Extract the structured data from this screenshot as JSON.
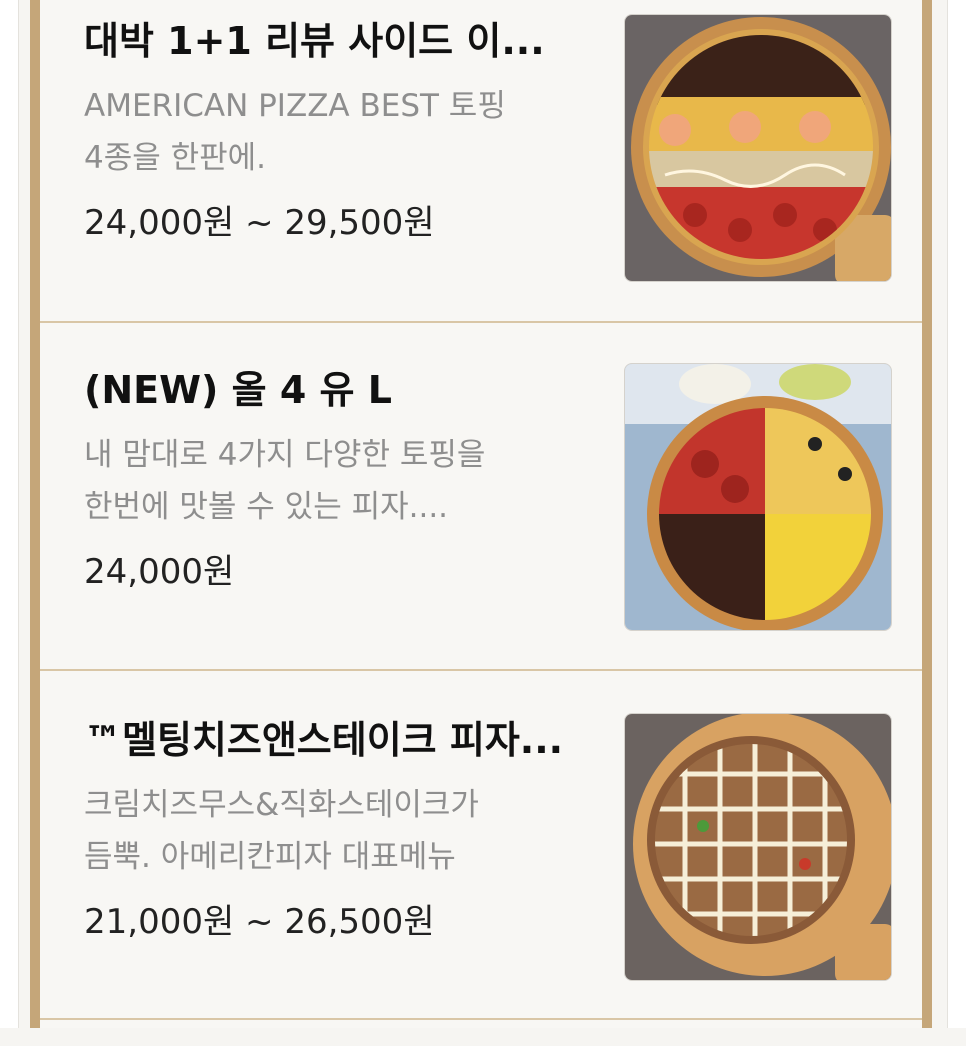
{
  "menu": {
    "items": [
      {
        "name": "대박 1+1 리뷰 사이드 이...",
        "description_line1": "AMERICAN PIZZA BEST 토핑",
        "description_line2": "4종을 한판에.",
        "price": "24,000원 ~ 29,500원",
        "image": "pizza-four-topping-photo"
      },
      {
        "name": "(NEW) 올 4 유 L",
        "description_line1": "내 맘대로 4가지 다양한 토핑을",
        "description_line2": "한번에 맛볼 수 있는 피자....",
        "price": "24,000원",
        "image": "pizza-all-4-you-photo"
      },
      {
        "name": "™멜팅치즈앤스테이크 피자...",
        "description_line1": "크림치즈무스&직화스테이크가",
        "description_line2": "듬뿍. 아메리칸피자 대표메뉴",
        "price": "21,000원 ~ 26,500원",
        "image": "pizza-melting-cheese-steak-photo"
      }
    ]
  },
  "colors": {
    "frame_border": "#c5a679",
    "divider": "#d9c6a6",
    "name": "#111111",
    "description": "#8e8e8e",
    "price": "#222222"
  }
}
